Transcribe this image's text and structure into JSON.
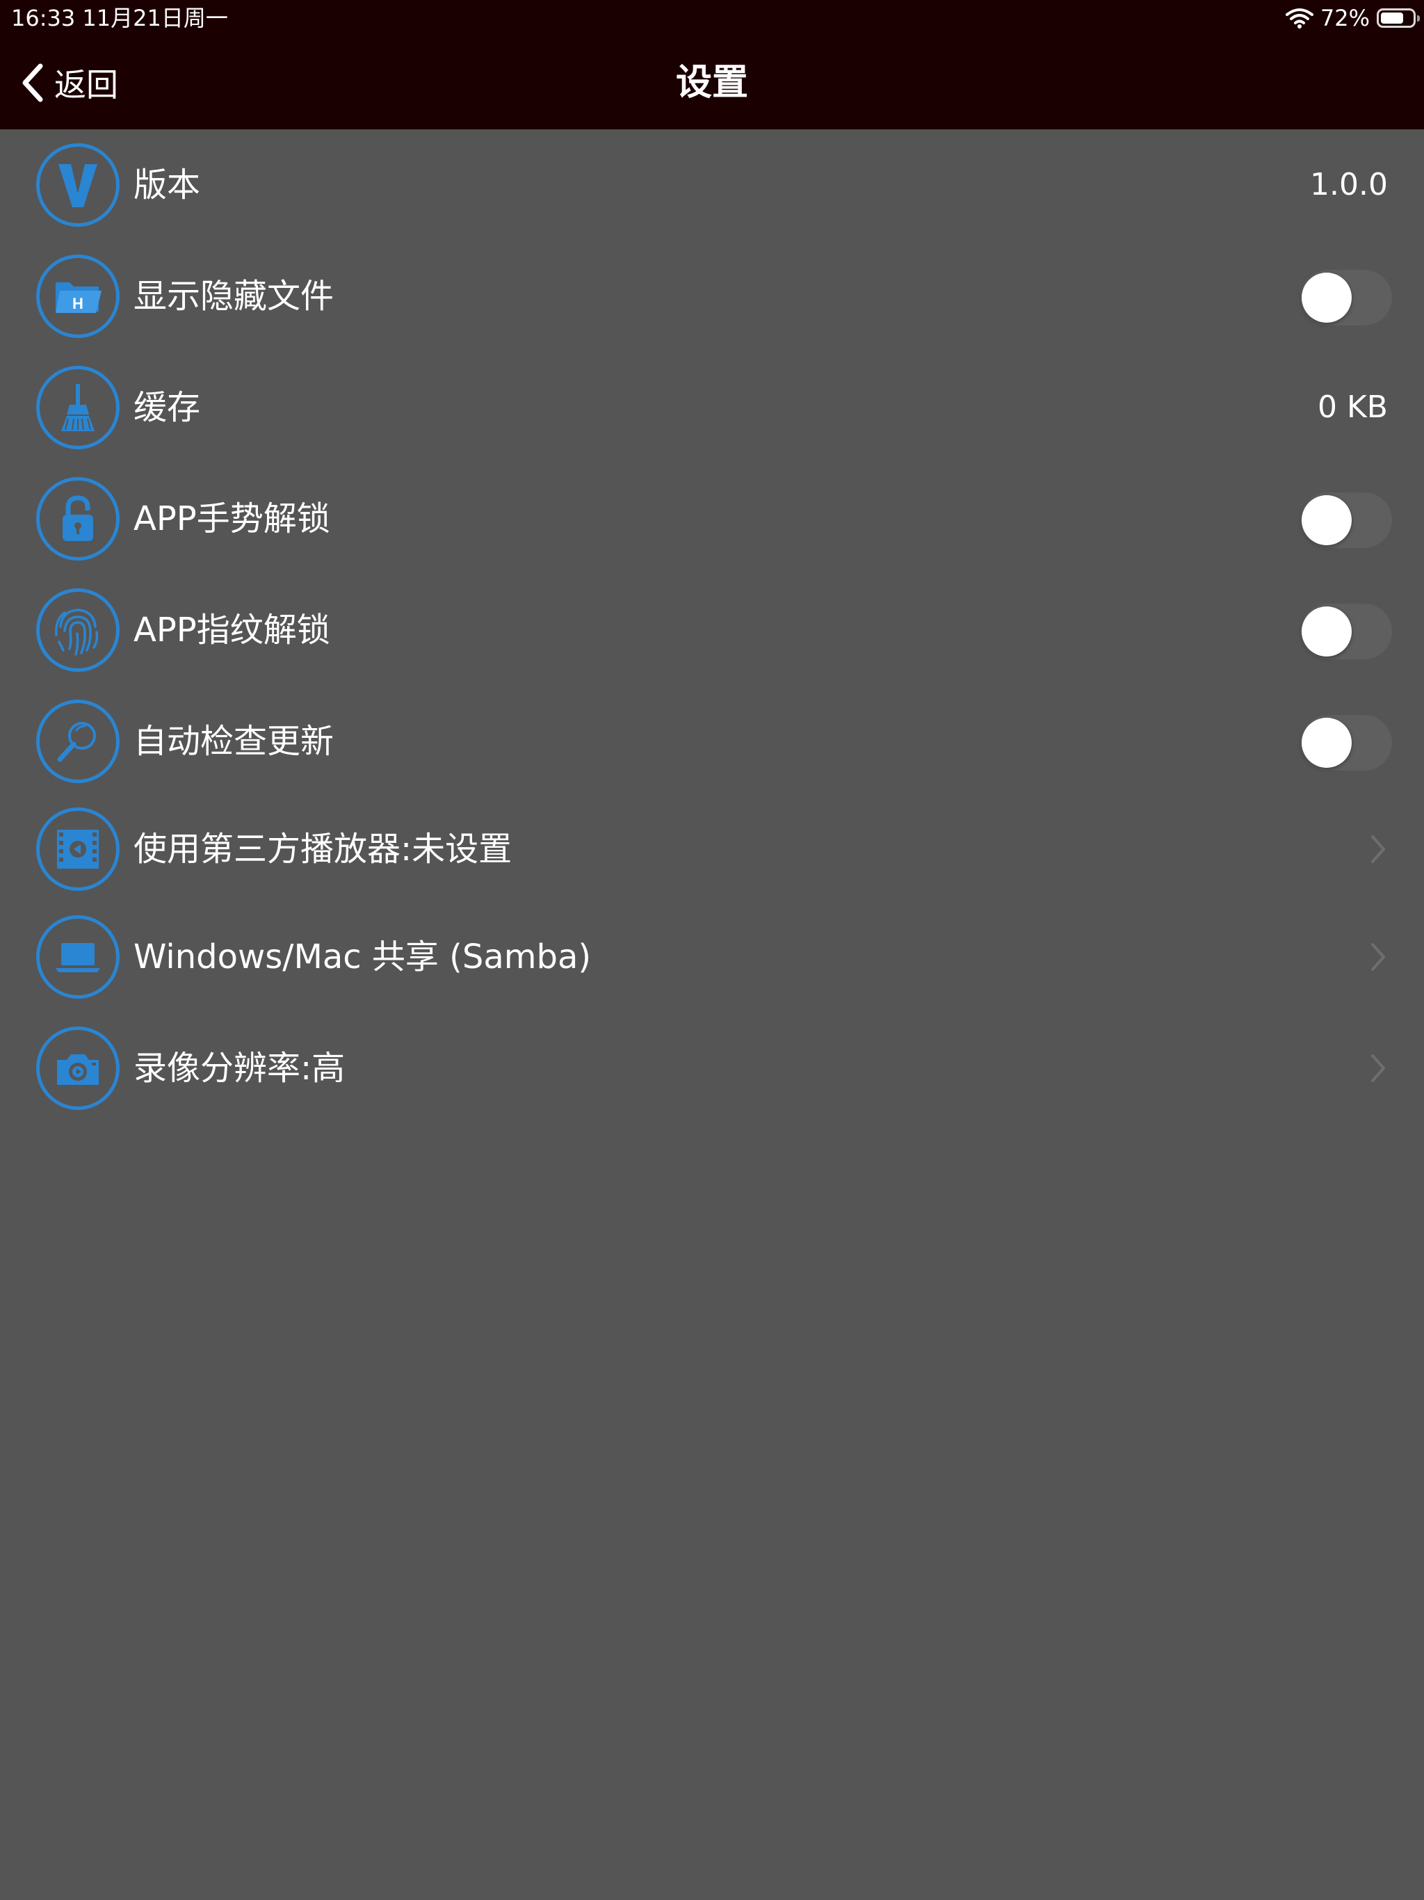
{
  "status_bar": {
    "time": "16:33   11月21日周一",
    "battery_percent_label": "72%",
    "battery_level": 0.72
  },
  "nav": {
    "back_label": "返回",
    "title": "设置"
  },
  "colors": {
    "nav_background": "#1b0002",
    "page_background": "#555555",
    "accent_blue": "#2a85d2",
    "text": "#ffffff"
  },
  "settings": [
    {
      "label": "版本",
      "icon": "v-letter-icon",
      "value": "1.0.0",
      "type": "value"
    },
    {
      "label": "显示隐藏文件",
      "icon": "hidden-folder-icon",
      "type": "toggle",
      "on": false
    },
    {
      "label": "缓存",
      "icon": "broom-icon",
      "value": "0 KB",
      "type": "value"
    },
    {
      "label": "APP手势解锁",
      "icon": "padlock-icon",
      "type": "toggle",
      "on": false
    },
    {
      "label": "APP指纹解锁",
      "icon": "fingerprint-icon",
      "type": "toggle",
      "on": false
    },
    {
      "label": "自动检查更新",
      "icon": "magnifier-icon",
      "type": "toggle",
      "on": false
    },
    {
      "label": "使用第三方播放器:未设置",
      "icon": "film-player-icon",
      "type": "link"
    },
    {
      "label": "Windows/Mac 共享 (Samba)",
      "icon": "laptop-icon",
      "type": "link"
    },
    {
      "label": "录像分辨率:高",
      "icon": "camera-icon",
      "type": "link"
    }
  ]
}
